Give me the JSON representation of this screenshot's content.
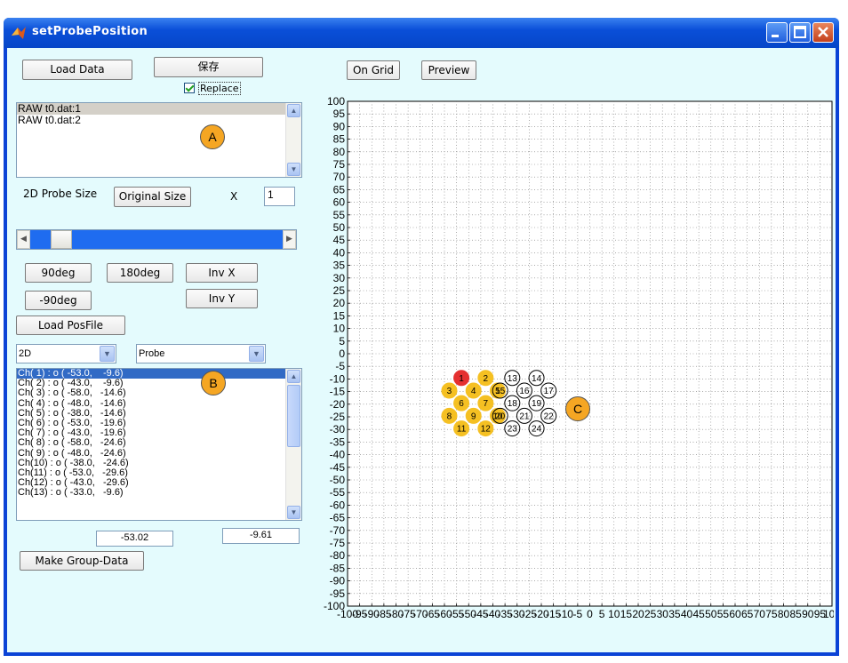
{
  "window": {
    "title": "setProbePosition"
  },
  "buttons": {
    "load_data": "Load Data",
    "save": "保存",
    "original_size": "Original Size",
    "deg90": "90deg",
    "deg180": "180deg",
    "inv_x": "Inv X",
    "deg_neg90": "-90deg",
    "inv_y": "Inv Y",
    "load_posfile": "Load PosFile",
    "make_group_data": "Make Group-Data",
    "on_grid": "On Grid",
    "preview": "Preview"
  },
  "replace_checkbox": {
    "label": "Replace",
    "checked": true
  },
  "data_list": {
    "items": [
      "RAW t0.dat:1",
      "RAW t0.dat:2"
    ],
    "selected_index": 0
  },
  "probe_size": {
    "label": "2D Probe Size",
    "x_label": "X",
    "x_value": "1",
    "slider_fraction": 0.1
  },
  "dropdowns": {
    "dim": "2D",
    "kind": "Probe"
  },
  "channel_list": {
    "items": [
      "Ch( 1) : o ( -53.0,    -9.6)",
      "Ch( 2) : o ( -43.0,    -9.6)",
      "Ch( 3) : o ( -58.0,   -14.6)",
      "Ch( 4) : o ( -48.0,   -14.6)",
      "Ch( 5) : o ( -38.0,   -14.6)",
      "Ch( 6) : o ( -53.0,   -19.6)",
      "Ch( 7) : o ( -43.0,   -19.6)",
      "Ch( 8) : o ( -58.0,   -24.6)",
      "Ch( 9) : o ( -48.0,   -24.6)",
      "Ch(10) : o ( -38.0,   -24.6)",
      "Ch(11) : o ( -53.0,   -29.6)",
      "Ch(12) : o ( -43.0,   -29.6)",
      "Ch(13) : o ( -33.0,   -9.6)"
    ],
    "selected_index": 0
  },
  "coords": {
    "x": "-53.02",
    "y": "-9.61"
  },
  "callouts": {
    "a": "A",
    "b": "B",
    "c": "C"
  },
  "plot": {
    "xlim": [
      -100,
      100
    ],
    "ylim": [
      -100,
      100
    ],
    "tick_step": 5,
    "y_tick_labels": [
      "100",
      "95",
      "90",
      "85",
      "80",
      "75",
      "70",
      "65",
      "60",
      "55",
      "50",
      "45",
      "40",
      "35",
      "30",
      "25",
      "20",
      "15",
      "10",
      "5",
      "0",
      "-5",
      "-10",
      "-15",
      "-20",
      "-25",
      "-30",
      "-35",
      "-40",
      "-45",
      "-50",
      "-55",
      "-60",
      "-65",
      "-70",
      "-75",
      "-80",
      "-85",
      "-90",
      "-95",
      "-100"
    ],
    "x_tick_labels": [
      "-100",
      "-95",
      "-90",
      "-85",
      "-80",
      "-75",
      "-70",
      "-65",
      "-60",
      "-55",
      "-50",
      "-45",
      "-40",
      "-35",
      "-30",
      "-25",
      "-20",
      "-15",
      "-10",
      "-5",
      "0",
      "5",
      "10",
      "15",
      "20",
      "25",
      "30",
      "35",
      "40",
      "45",
      "50",
      "55",
      "60",
      "65",
      "70",
      "75",
      "80",
      "85",
      "90",
      "95",
      "100"
    ],
    "colors": {
      "selected": "#e53030",
      "probe_fill": "#f5c022",
      "probe_ring": "#000000"
    },
    "filled_probes": [
      {
        "label": "1",
        "x": -53,
        "y": -9.6
      },
      {
        "label": "2",
        "x": -43,
        "y": -9.6
      },
      {
        "label": "3",
        "x": -58,
        "y": -14.6
      },
      {
        "label": "4",
        "x": -48,
        "y": -14.6
      },
      {
        "label": "5",
        "x": -38,
        "y": -14.6
      },
      {
        "label": "6",
        "x": -53,
        "y": -19.6
      },
      {
        "label": "7",
        "x": -43,
        "y": -19.6
      },
      {
        "label": "8",
        "x": -58,
        "y": -24.6
      },
      {
        "label": "9",
        "x": -48,
        "y": -24.6
      },
      {
        "label": "10",
        "x": -38,
        "y": -24.6
      },
      {
        "label": "11",
        "x": -53,
        "y": -29.6
      },
      {
        "label": "12",
        "x": -43,
        "y": -29.6
      }
    ],
    "ring_probes": [
      {
        "label": "13",
        "x": -32,
        "y": -9.6
      },
      {
        "label": "14",
        "x": -22,
        "y": -9.6
      },
      {
        "label": "15",
        "x": -37,
        "y": -14.6
      },
      {
        "label": "16",
        "x": -27,
        "y": -14.6
      },
      {
        "label": "17",
        "x": -17,
        "y": -14.6
      },
      {
        "label": "18",
        "x": -32,
        "y": -19.6
      },
      {
        "label": "19",
        "x": -22,
        "y": -19.6
      },
      {
        "label": "20",
        "x": -37,
        "y": -24.6
      },
      {
        "label": "21",
        "x": -27,
        "y": -24.6
      },
      {
        "label": "22",
        "x": -17,
        "y": -24.6
      },
      {
        "label": "23",
        "x": -32,
        "y": -29.6
      },
      {
        "label": "24",
        "x": -22,
        "y": -29.6
      }
    ],
    "selected_label": "1"
  }
}
